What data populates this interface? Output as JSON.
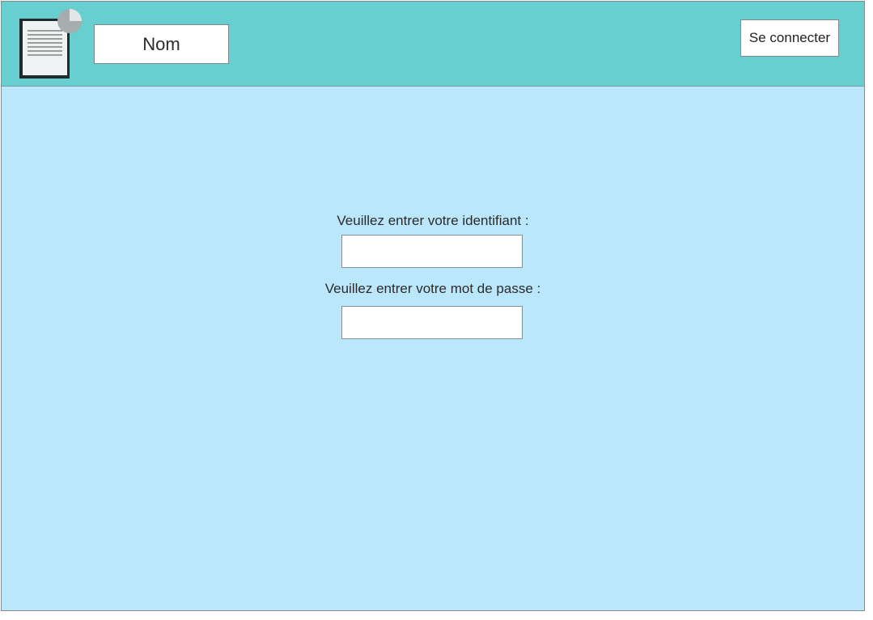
{
  "header": {
    "logo_icon": "document-chart-icon",
    "name_label": "Nom",
    "login_button": "Se connecter"
  },
  "form": {
    "id_label": "Veuillez entrer votre identifiant :",
    "id_value": "",
    "password_label": "Veuillez entrer votre mot de passe :",
    "password_value": ""
  },
  "colors": {
    "header_bg": "#67cfcf",
    "content_bg": "#bbe7fc"
  }
}
